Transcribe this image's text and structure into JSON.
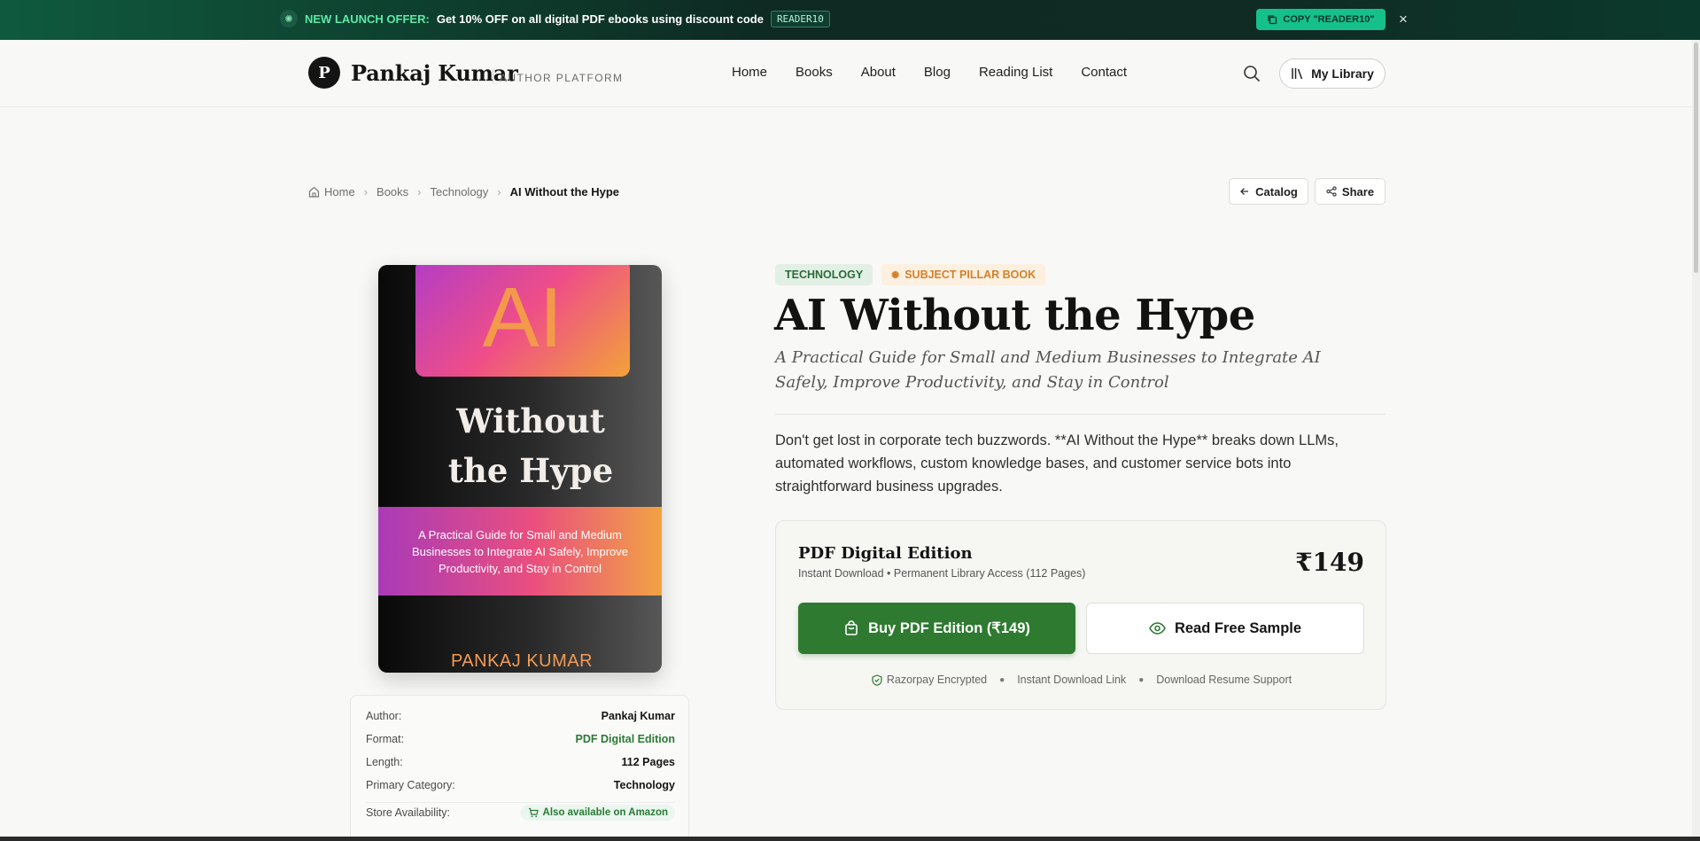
{
  "promo": {
    "highlight": "NEW LAUNCH OFFER:",
    "text": "Get 10% OFF on all digital PDF ebooks using discount code",
    "code": "READER10",
    "copy_label": "COPY \"READER10\"",
    "close": "×"
  },
  "header": {
    "logo_letter": "P",
    "brand": "Pankaj Kumar",
    "brand_sub": "AUTHOR PLATFORM",
    "nav": [
      "Home",
      "Books",
      "About",
      "Blog",
      "Reading List",
      "Contact"
    ],
    "library_label": "My Library"
  },
  "breadcrumb": {
    "items": [
      "Home",
      "Books",
      "Technology"
    ],
    "current": "AI Without the Hype",
    "catalog_label": "Catalog",
    "share_label": "Share"
  },
  "cover": {
    "ai": "AI",
    "title": "Without the Hype",
    "band": "A Practical Guide for Small and Medium Businesses to Integrate AI Safely, Improve Productivity, and Stay in Control",
    "author": "PANKAJ KUMAR"
  },
  "details": {
    "rows": [
      {
        "k": "Author:",
        "v": "Pankaj Kumar"
      },
      {
        "k": "Format:",
        "v": "PDF Digital Edition"
      },
      {
        "k": "Length:",
        "v": "112 Pages"
      },
      {
        "k": "Primary Category:",
        "v": "Technology"
      }
    ],
    "store_label": "Store Availability:",
    "store_value": "Also available on Amazon"
  },
  "book": {
    "tag_category": "TECHNOLOGY",
    "tag_pillar": "SUBJECT PILLAR BOOK",
    "title": "AI Without the Hype",
    "subtitle": "A Practical Guide for Small and Medium Businesses to Integrate AI Safely, Improve Productivity, and Stay in Control",
    "description": "Don't get lost in corporate tech buzzwords. **AI Without the Hype** breaks down LLMs, automated workflows, custom knowledge bases, and customer service bots into straightforward business upgrades."
  },
  "buybox": {
    "edition": "PDF Digital Edition",
    "meta": "Instant Download • Permanent Library Access (112 Pages)",
    "price": "₹149",
    "buy_label": "Buy PDF Edition (₹149)",
    "sample_label": "Read Free Sample",
    "trust": [
      "Razorpay Encrypted",
      "Instant Download Link",
      "Download Resume Support"
    ]
  },
  "colors": {
    "accent_green": "#2e7a30",
    "promo_green": "#16c08a",
    "pillar_orange": "#d5802a"
  },
  "icons": [
    "sparkle-icon",
    "copy-icon",
    "close-icon",
    "search-icon",
    "library-icon",
    "home-icon",
    "chevron-right-icon",
    "arrow-left-icon",
    "share-icon",
    "cart-icon",
    "bag-icon",
    "eye-icon",
    "shield-check-icon"
  ]
}
